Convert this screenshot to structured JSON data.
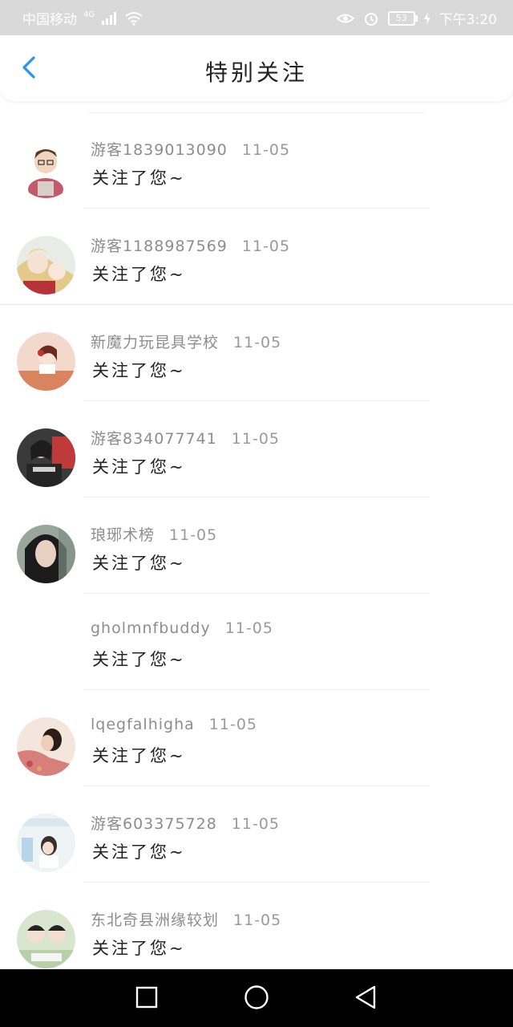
{
  "status_bar": {
    "carrier": "中国移动",
    "network": "4G",
    "battery": "53",
    "time": "下午3:20"
  },
  "header": {
    "title": "特别关注",
    "back_icon": "chevron-left-icon"
  },
  "colors": {
    "accent": "#2196F3",
    "status_bar_bg": "#d9d9d9",
    "nav_bar_bg": "#000000"
  },
  "items": [
    {
      "name": "游客1839013090",
      "date": "11-05",
      "message": "关注了您~",
      "avatar": "cartoon-boy-avatar"
    },
    {
      "name": "游客1188987569",
      "date": "11-05",
      "message": "关注了您~",
      "avatar": "anime-girl-avatar"
    },
    {
      "name": "新魔力玩昆具学校",
      "date": "11-05",
      "message": "关注了您~",
      "avatar": "illustrated-girl-avatar"
    },
    {
      "name": "游客834077741",
      "date": "11-05",
      "message": "关注了您~",
      "avatar": "photo-person-avatar"
    },
    {
      "name": "琅琊术榜",
      "date": "11-05",
      "message": "关注了您~",
      "avatar": "photo-woman-avatar"
    },
    {
      "name": "gholmnfbuddy",
      "date": "11-05",
      "message": "关注了您~",
      "avatar": ""
    },
    {
      "name": "lqegfalhigha",
      "date": "11-05",
      "message": "关注了您~",
      "avatar": "photo-girl-avatar"
    },
    {
      "name": "游客603375728",
      "date": "11-05",
      "message": "关注了您~",
      "avatar": "illustrated-poster-avatar"
    },
    {
      "name": "东北奇县洲缘较划",
      "date": "11-05",
      "message": "关注了您~",
      "avatar": "cartoon-pair-avatar"
    }
  ],
  "nav": {
    "recent": "square-icon",
    "home": "circle-icon",
    "back": "triangle-back-icon"
  }
}
